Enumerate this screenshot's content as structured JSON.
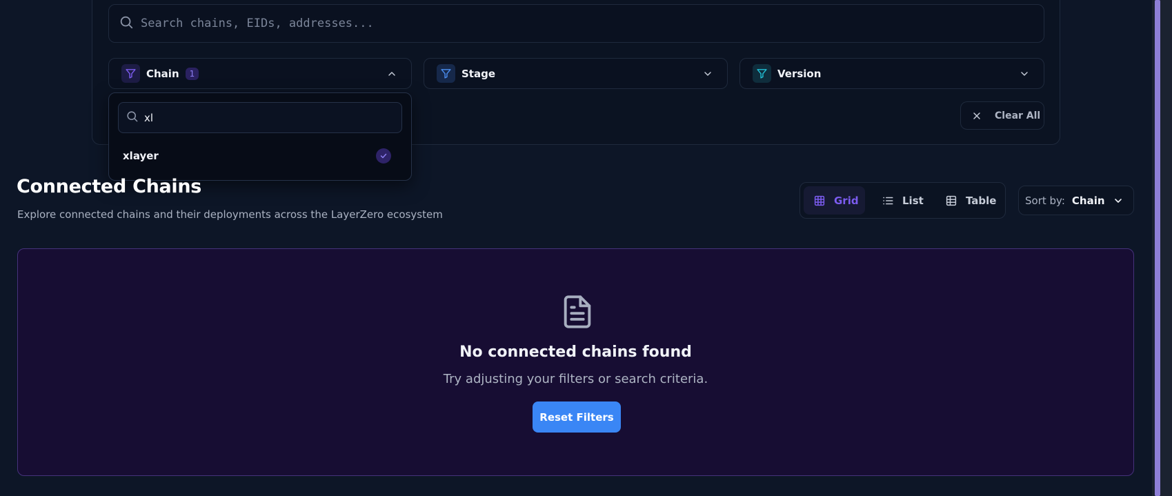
{
  "search": {
    "placeholder": "Search chains, EIDs, addresses..."
  },
  "filters": {
    "chain": {
      "label": "Chain",
      "count": "1",
      "icon": "filter-icon",
      "accent": "#7c5cf0",
      "expanded": true
    },
    "stage": {
      "label": "Stage",
      "icon": "filter-icon",
      "accent": "#4b8ef0"
    },
    "version": {
      "label": "Version",
      "icon": "filter-icon",
      "accent": "#22c1d6"
    },
    "clear_all_label": "Clear All"
  },
  "chain_dropdown": {
    "search_value": "xl",
    "options": [
      {
        "label": "xlayer",
        "selected": true
      }
    ]
  },
  "section": {
    "title": "Connected Chains",
    "subtitle": "Explore connected chains and their deployments across the LayerZero ecosystem"
  },
  "view_toggle": {
    "active": "Grid",
    "options": [
      {
        "label": "Grid",
        "icon": "grid-icon"
      },
      {
        "label": "List",
        "icon": "list-icon"
      },
      {
        "label": "Table",
        "icon": "table-icon"
      }
    ]
  },
  "sort": {
    "label": "Sort by:",
    "value": "Chain"
  },
  "empty_state": {
    "icon": "document-icon",
    "title": "No connected chains found",
    "message": "Try adjusting your filters or search criteria.",
    "button_label": "Reset Filters"
  },
  "colors": {
    "background": "#0d1627",
    "accent_purple": "#7c5cf0",
    "primary_button": "#3a86f5",
    "empty_state_bg": "#170d33"
  }
}
